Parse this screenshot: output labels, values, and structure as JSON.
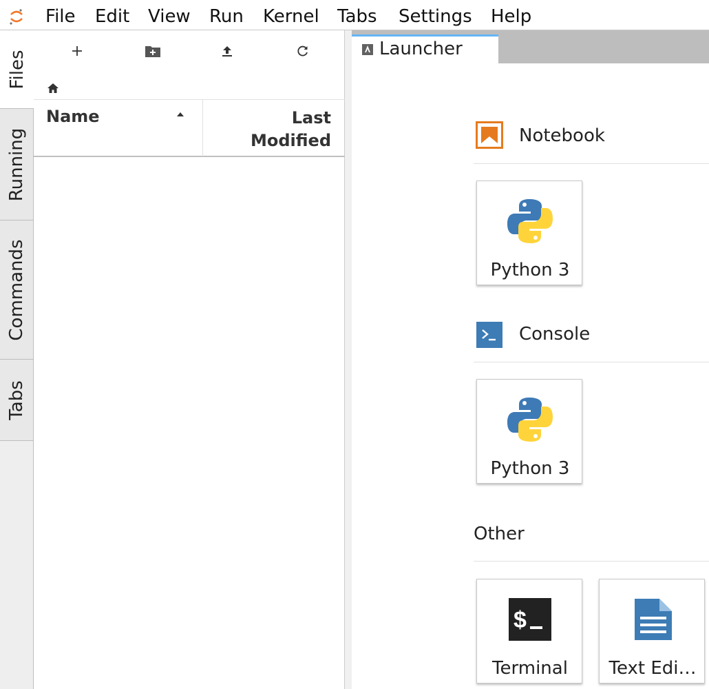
{
  "menubar": {
    "items": [
      "File",
      "Edit",
      "View",
      "Run",
      "Kernel",
      "Tabs",
      "Settings",
      "Help"
    ]
  },
  "sidebar": {
    "tabs": [
      {
        "label": "Files",
        "active": true
      },
      {
        "label": "Running",
        "active": false
      },
      {
        "label": "Commands",
        "active": false
      },
      {
        "label": "Tabs",
        "active": false
      }
    ]
  },
  "filebrowser": {
    "columns": {
      "name": "Name",
      "last_modified": "Last Modified"
    },
    "items": []
  },
  "main": {
    "tabs": [
      {
        "label": "Launcher",
        "active": true
      }
    ]
  },
  "launcher": {
    "sections": [
      {
        "title": "Notebook",
        "icon": "notebook-icon",
        "cards": [
          {
            "label": "Python 3",
            "icon": "python-logo-icon"
          }
        ]
      },
      {
        "title": "Console",
        "icon": "console-icon",
        "cards": [
          {
            "label": "Python 3",
            "icon": "python-logo-icon"
          }
        ]
      },
      {
        "title": "Other",
        "icon": "",
        "cards": [
          {
            "label": "Terminal",
            "icon": "terminal-icon"
          },
          {
            "label": "Text Edi…",
            "icon": "text-editor-icon"
          }
        ]
      }
    ]
  },
  "colors": {
    "accent": "#64b5f6",
    "notebook": "#e57b1e",
    "console": "#3d7cb5",
    "terminal": "#222222"
  }
}
